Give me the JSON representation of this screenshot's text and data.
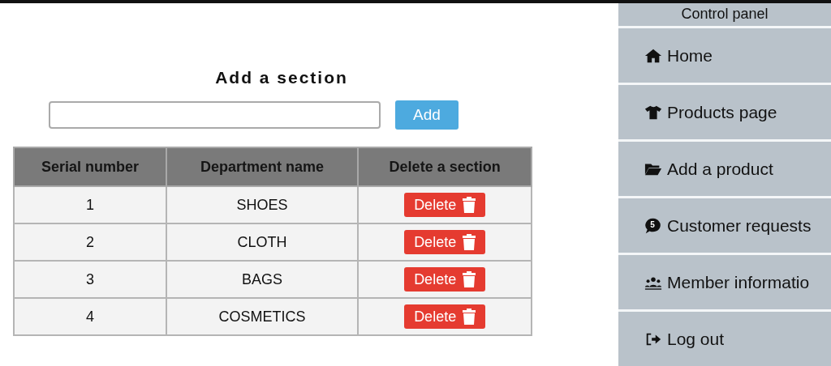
{
  "main": {
    "title": "Add a section",
    "add_button": "Add"
  },
  "table": {
    "columns": [
      "Serial number",
      "Department name",
      "Delete a section"
    ],
    "rows": [
      {
        "serial": "1",
        "name": "SHOES",
        "action": "Delete"
      },
      {
        "serial": "2",
        "name": "CLOTH",
        "action": "Delete"
      },
      {
        "serial": "3",
        "name": "BAGS",
        "action": "Delete"
      },
      {
        "serial": "4",
        "name": "COSMETICS",
        "action": "Delete"
      }
    ]
  },
  "sidebar": {
    "title": "Control panel",
    "items": [
      {
        "kind": "home",
        "label": "Home"
      },
      {
        "kind": "shirt",
        "label": "Products page"
      },
      {
        "kind": "folder",
        "label": "Add a product"
      },
      {
        "kind": "chat",
        "label": "Customer requests",
        "badge": "5"
      },
      {
        "kind": "users",
        "label": "Member informatio"
      },
      {
        "kind": "logout",
        "label": "Log out"
      }
    ]
  }
}
